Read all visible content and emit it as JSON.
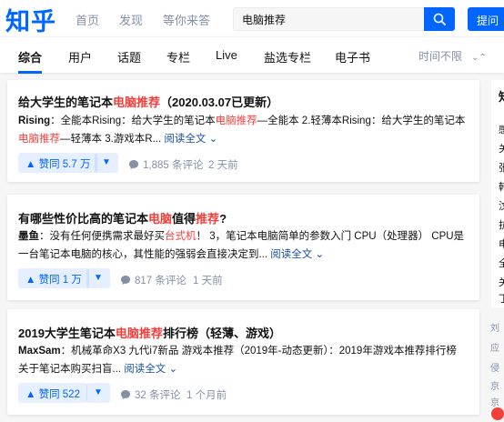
{
  "header": {
    "logo": "知乎",
    "nav": [
      "首页",
      "发现",
      "等你来答"
    ],
    "search_value": "电脑推荐",
    "ask_label": "提问"
  },
  "tabs": [
    "综合",
    "用户",
    "话题",
    "专栏",
    "Live",
    "盐选专栏",
    "电子书"
  ],
  "time_filter": "时间不限",
  "results": [
    {
      "title_a": "给大学生的笔记本",
      "title_hl": "电脑推荐",
      "title_b": "（2020.03.07已更新）",
      "author": "Rising",
      "body_a": "：全能本Rising：给大学生的笔记本",
      "body_hl1": "电脑推荐",
      "body_b": "—全能本 2.轻薄本Rising：给大学生的笔记本",
      "body_hl2": "电脑推荐",
      "body_c": "—轻薄本 3.游戏本R... ",
      "read_more": "阅读全文",
      "votes": "▲ 赞同 5.7 万",
      "comments": "1,885 条评论",
      "time": "2 天前"
    },
    {
      "title_a": "有哪些性价比高的笔记本",
      "title_hl1": "电脑",
      "title_b": "值得",
      "title_hl2": "推荐",
      "title_c": "?",
      "author": "墨鱼",
      "body_a": "：没有任何便携需求最好买",
      "body_hl": "台式机",
      "body_b": "！ 3，笔记本电脑简单的参数入门 CPU（处理器） CPU是一台笔记本电脑的核心，其性能的强弱会直接决定到... ",
      "read_more": "阅读全文",
      "votes": "▲ 赞同 1 万",
      "comments": "817 条评论",
      "time": "1 天前"
    },
    {
      "title_a": "2019大学生笔记本",
      "title_hl": "电脑推荐",
      "title_b": "排行榜（轻薄、游戏）",
      "author": "MaxSam",
      "body_a": "：机械革命X3 九代i7新品 游戏本推荐（2019年-动态更新）：2019年游戏本推荐排行榜 关于笔记本购买扫盲... ",
      "read_more": "阅读全文",
      "votes": "▲ 赞同 522",
      "comments": "32 条评论",
      "time": "1 个月前"
    }
  ],
  "sidebar": {
    "chars": [
      "知",
      "感",
      "关",
      "张",
      "韩",
      "汶",
      "抗",
      "电",
      "全",
      "关",
      "丁"
    ],
    "foot": [
      "刘",
      "应",
      "侵",
      "京",
      "京"
    ]
  },
  "icons": {
    "search": "search-icon",
    "comment": "comment-icon",
    "chevron": "chevron-down-icon",
    "updown": "sort-chevron-icon"
  },
  "colors": {
    "brand": "#0066ff",
    "highlight": "#f1403c",
    "muted": "#8590a6",
    "link": "#175199"
  }
}
